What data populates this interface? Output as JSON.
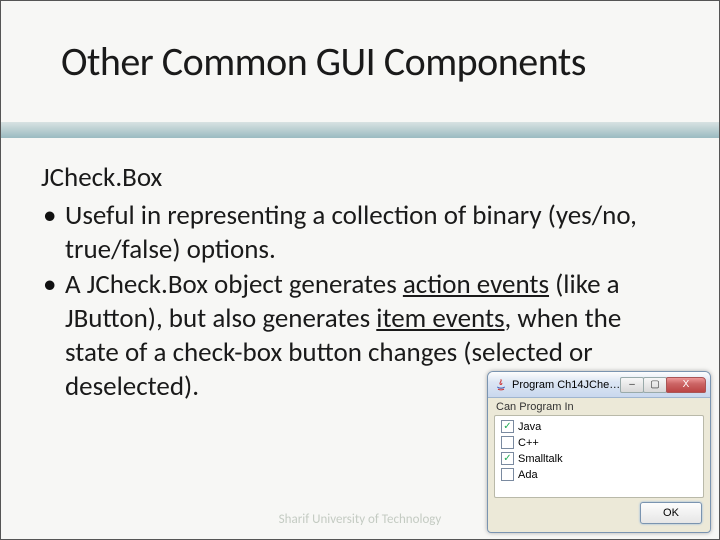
{
  "title": "Other Common GUI Components",
  "subheading": "JCheck.Box",
  "bullets": [
    {
      "pre": "Useful in representing a collection of binary (yes/no, true/false) options.",
      "u1": "",
      "mid": "",
      "u2": "",
      "post": ""
    },
    {
      "pre": "A JCheck.Box object generates ",
      "u1": "action events",
      "mid": " (like a JButton), but also generates ",
      "u2": "item events",
      "post": ", when the state of a check-box button changes (selected or deselected)."
    }
  ],
  "footer": "Sharif University of Technology",
  "window": {
    "title": "Program Ch14JCheckBoxSa...",
    "panel_label": "Can Program In",
    "items": [
      {
        "label": "Java",
        "checked": true
      },
      {
        "label": "C++",
        "checked": false
      },
      {
        "label": "Smalltalk",
        "checked": true
      },
      {
        "label": "Ada",
        "checked": false
      }
    ],
    "ok_label": "OK",
    "icons": {
      "min": "–",
      "max": "▢",
      "close": "X",
      "check": "✓"
    }
  }
}
